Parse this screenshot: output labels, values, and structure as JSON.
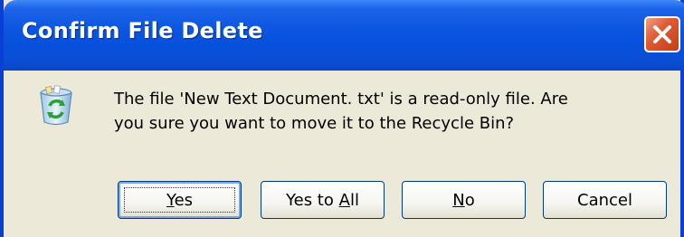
{
  "window": {
    "title": "Confirm File Delete",
    "message_line1": "The file 'New Text Document. txt' is a read-only file. Are",
    "message_line2": "you sure you want to move it to the Recycle Bin?",
    "icon": "recycle-bin-icon"
  },
  "buttons": {
    "yes": {
      "pre": "",
      "mnemonic": "Y",
      "post": "es"
    },
    "yes_to_all": {
      "pre": "Yes to ",
      "mnemonic": "A",
      "post": "ll"
    },
    "no": {
      "pre": "",
      "mnemonic": "N",
      "post": "o"
    },
    "cancel": {
      "pre": "Cancel",
      "mnemonic": "",
      "post": ""
    }
  },
  "colors": {
    "titlebar": "#0A55DF",
    "dialog_bg": "#ECE9D8",
    "close_button": "#E05B35",
    "button_border": "#003C74"
  }
}
